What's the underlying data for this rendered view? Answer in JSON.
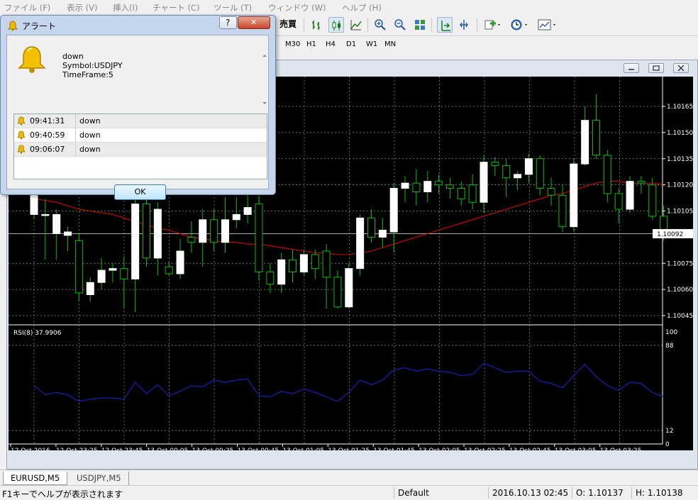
{
  "menu": {
    "items": [
      "ファイル (F)",
      "表示 (V)",
      "挿入(I)",
      "チャート (C)",
      "ツール (T)",
      "ウィンドウ (W)",
      "ヘルプ (H)"
    ]
  },
  "toolbar": {
    "trade_label": "売買",
    "timeframes": [
      "M30",
      "H1",
      "H4",
      "D1",
      "W1",
      "MN"
    ]
  },
  "alert_dialog": {
    "title": "アラート",
    "help_label": "?",
    "close_label": "✕",
    "message": {
      "line1": "down",
      "line2": "Symbol:USDJPY",
      "line3": "TimeFrame:5"
    },
    "rows": [
      {
        "time": "09:41:31",
        "message": "down"
      },
      {
        "time": "09:40:59",
        "message": "down"
      },
      {
        "time": "09:06:07",
        "message": "down"
      }
    ],
    "ok_label": "OK"
  },
  "chart": {
    "current_price": "1.10092",
    "rsi_label": "RSI(8) 37.9906",
    "colors": {
      "background": "#000000",
      "bull_candle": "#ffffff",
      "wick": "#00c000",
      "band": "#dd0000",
      "rsi": "#1a1aa0",
      "grid": "#c0c0c0"
    }
  },
  "chart_data": {
    "type": "candlestick",
    "symbol": "EURUSD,M5",
    "price_ticks": [
      "1.10165",
      "1.10150",
      "1.10135",
      "1.10120",
      "1.10105",
      "1.10075",
      "1.10060",
      "1.10045"
    ],
    "rsi_ticks": [
      "100",
      "88",
      "12",
      "0"
    ],
    "time_ticks": [
      "12 Oct 2016",
      "12 Oct 23:25",
      "12 Oct 23:45",
      "13 Oct 00:05",
      "13 Oct 00:25",
      "13 Oct 00:45",
      "13 Oct 01:05",
      "13 Oct 01:25",
      "13 Oct 01:45",
      "13 Oct 02:05",
      "13 Oct 02:25",
      "13 Oct 02:45",
      "13 Oct 03:05",
      "13 Oct 03:25"
    ],
    "rsi_levels": [
      88,
      12
    ],
    "candles": [
      {
        "o": 1.10103,
        "c": 1.10125,
        "h": 1.10132,
        "l": 1.101
      },
      {
        "o": 1.10103,
        "c": 1.10103,
        "h": 1.10112,
        "l": 1.10077
      },
      {
        "o": 1.10092,
        "c": 1.10103,
        "h": 1.10106,
        "l": 1.10077
      },
      {
        "o": 1.10091,
        "c": 1.10093,
        "h": 1.10096,
        "l": 1.10082
      },
      {
        "o": 1.10088,
        "c": 1.10058,
        "h": 1.10092,
        "l": 1.10053
      },
      {
        "o": 1.10057,
        "c": 1.10064,
        "h": 1.10067,
        "l": 1.10053
      },
      {
        "o": 1.10064,
        "c": 1.10071,
        "h": 1.10078,
        "l": 1.1006
      },
      {
        "o": 1.10071,
        "c": 1.10072,
        "h": 1.10075,
        "l": 1.10064
      },
      {
        "o": 1.10072,
        "c": 1.10066,
        "h": 1.10079,
        "l": 1.10049
      },
      {
        "o": 1.10066,
        "c": 1.10109,
        "h": 1.10112,
        "l": 1.10047
      },
      {
        "o": 1.10109,
        "c": 1.10078,
        "h": 1.10112,
        "l": 1.10073
      },
      {
        "o": 1.10078,
        "c": 1.10106,
        "h": 1.1011,
        "l": 1.10068
      },
      {
        "o": 1.10073,
        "c": 1.10069,
        "h": 1.10076,
        "l": 1.10068
      },
      {
        "o": 1.10069,
        "c": 1.10082,
        "h": 1.10089,
        "l": 1.10066
      },
      {
        "o": 1.1009,
        "c": 1.10087,
        "h": 1.10099,
        "l": 1.10081
      },
      {
        "o": 1.10087,
        "c": 1.101,
        "h": 1.10106,
        "l": 1.10073
      },
      {
        "o": 1.101,
        "c": 1.10087,
        "h": 1.10106,
        "l": 1.10082
      },
      {
        "o": 1.10087,
        "c": 1.101,
        "h": 1.10113,
        "l": 1.10081
      },
      {
        "o": 1.101,
        "c": 1.10103,
        "h": 1.10113,
        "l": 1.10095
      },
      {
        "o": 1.10103,
        "c": 1.10107,
        "h": 1.10115,
        "l": 1.10098
      },
      {
        "o": 1.10109,
        "c": 1.1007,
        "h": 1.10114,
        "l": 1.10065
      },
      {
        "o": 1.1007,
        "c": 1.10063,
        "h": 1.10075,
        "l": 1.10058
      },
      {
        "o": 1.10063,
        "c": 1.10077,
        "h": 1.10081,
        "l": 1.10058
      },
      {
        "o": 1.10077,
        "c": 1.1007,
        "h": 1.10083,
        "l": 1.10064
      },
      {
        "o": 1.1007,
        "c": 1.1008,
        "h": 1.10083,
        "l": 1.10068
      },
      {
        "o": 1.1008,
        "c": 1.10072,
        "h": 1.10083,
        "l": 1.10066
      },
      {
        "o": 1.10082,
        "c": 1.10067,
        "h": 1.10086,
        "l": 1.10049
      },
      {
        "o": 1.10067,
        "c": 1.1005,
        "h": 1.10071,
        "l": 1.10049
      },
      {
        "o": 1.1005,
        "c": 1.10072,
        "h": 1.10075,
        "l": 1.10049
      },
      {
        "o": 1.10072,
        "c": 1.10101,
        "h": 1.10103,
        "l": 1.10068
      },
      {
        "o": 1.10101,
        "c": 1.1009,
        "h": 1.10106,
        "l": 1.10087
      },
      {
        "o": 1.1009,
        "c": 1.10094,
        "h": 1.10101,
        "l": 1.10084
      },
      {
        "o": 1.10093,
        "c": 1.10118,
        "h": 1.10121,
        "l": 1.10081
      },
      {
        "o": 1.10118,
        "c": 1.10121,
        "h": 1.10125,
        "l": 1.1011
      },
      {
        "o": 1.10121,
        "c": 1.10116,
        "h": 1.10129,
        "l": 1.10108
      },
      {
        "o": 1.10116,
        "c": 1.10122,
        "h": 1.10128,
        "l": 1.1011
      },
      {
        "o": 1.10122,
        "c": 1.1012,
        "h": 1.10126,
        "l": 1.10115
      },
      {
        "o": 1.1012,
        "c": 1.10118,
        "h": 1.10124,
        "l": 1.10112
      },
      {
        "o": 1.10118,
        "c": 1.10112,
        "h": 1.10122,
        "l": 1.10108
      },
      {
        "o": 1.1012,
        "c": 1.1011,
        "h": 1.10126,
        "l": 1.10106
      },
      {
        "o": 1.1011,
        "c": 1.10133,
        "h": 1.10137,
        "l": 1.10104
      },
      {
        "o": 1.10133,
        "c": 1.10131,
        "h": 1.10136,
        "l": 1.10125
      },
      {
        "o": 1.10131,
        "c": 1.10124,
        "h": 1.10135,
        "l": 1.10113
      },
      {
        "o": 1.10124,
        "c": 1.10126,
        "h": 1.10128,
        "l": 1.10117
      },
      {
        "o": 1.10126,
        "c": 1.10135,
        "h": 1.10138,
        "l": 1.10121
      },
      {
        "o": 1.10135,
        "c": 1.10118,
        "h": 1.10137,
        "l": 1.10114
      },
      {
        "o": 1.10118,
        "c": 1.10114,
        "h": 1.10124,
        "l": 1.10108
      },
      {
        "o": 1.10114,
        "c": 1.10096,
        "h": 1.1012,
        "l": 1.10093
      },
      {
        "o": 1.10096,
        "c": 1.10132,
        "h": 1.10135,
        "l": 1.10093
      },
      {
        "o": 1.10132,
        "c": 1.10157,
        "h": 1.10165,
        "l": 1.10131
      },
      {
        "o": 1.10157,
        "c": 1.10137,
        "h": 1.10172,
        "l": 1.10135
      },
      {
        "o": 1.10137,
        "c": 1.10115,
        "h": 1.1014,
        "l": 1.1011
      },
      {
        "o": 1.10115,
        "c": 1.10106,
        "h": 1.10118,
        "l": 1.10098
      },
      {
        "o": 1.10106,
        "c": 1.10122,
        "h": 1.10125,
        "l": 1.10104
      },
      {
        "o": 1.10122,
        "c": 1.10121,
        "h": 1.10125,
        "l": 1.10115
      },
      {
        "o": 1.1012,
        "c": 1.10102,
        "h": 1.10124,
        "l": 1.101
      },
      {
        "o": 1.10102,
        "c": 1.10094,
        "h": 1.10108,
        "l": 1.10088
      }
    ],
    "bb_upper": [
      1.10112,
      1.10111,
      1.1011,
      1.10108,
      1.10106,
      1.10105,
      1.10104,
      1.10103,
      1.10101,
      1.10099,
      1.10097,
      1.10095,
      1.10094,
      1.10092,
      1.1009,
      1.10089,
      1.10088,
      1.10087,
      1.10087,
      1.10086,
      1.10086,
      1.10085,
      1.10084,
      1.10083,
      1.10082,
      1.10081,
      1.10081,
      1.1008,
      1.1008,
      1.10081,
      1.10082,
      1.10084,
      1.10086,
      1.10088,
      1.1009,
      1.10092,
      1.10094,
      1.10096,
      1.10098,
      1.101,
      1.10102,
      1.10104,
      1.10106,
      1.10108,
      1.1011,
      1.10112,
      1.10114,
      1.10115,
      1.10117,
      1.10119,
      1.10121,
      1.10122,
      1.10122,
      1.10121,
      1.10121,
      1.10121,
      1.1012
    ],
    "rsi": [
      52,
      44,
      46,
      44,
      38,
      40,
      41,
      41,
      40,
      55,
      45,
      53,
      43,
      47,
      52,
      51,
      57,
      55,
      57,
      58,
      43,
      42,
      47,
      45,
      49,
      46,
      42,
      38,
      46,
      57,
      53,
      57,
      66,
      68,
      65,
      67,
      65,
      64,
      61,
      62,
      72,
      68,
      64,
      65,
      65,
      56,
      54,
      50,
      61,
      71,
      60,
      52,
      48,
      55,
      54,
      46,
      42
    ]
  },
  "bottom_tabs": [
    "EURUSD,M5",
    "USDJPY,M5"
  ],
  "status_bar": {
    "help_text": "F1キーでヘルプが表示されます",
    "profile": "Default",
    "datetime": "2016.10.13 02:45",
    "open": "O: 1.10137",
    "high": "H: 1.10138"
  }
}
